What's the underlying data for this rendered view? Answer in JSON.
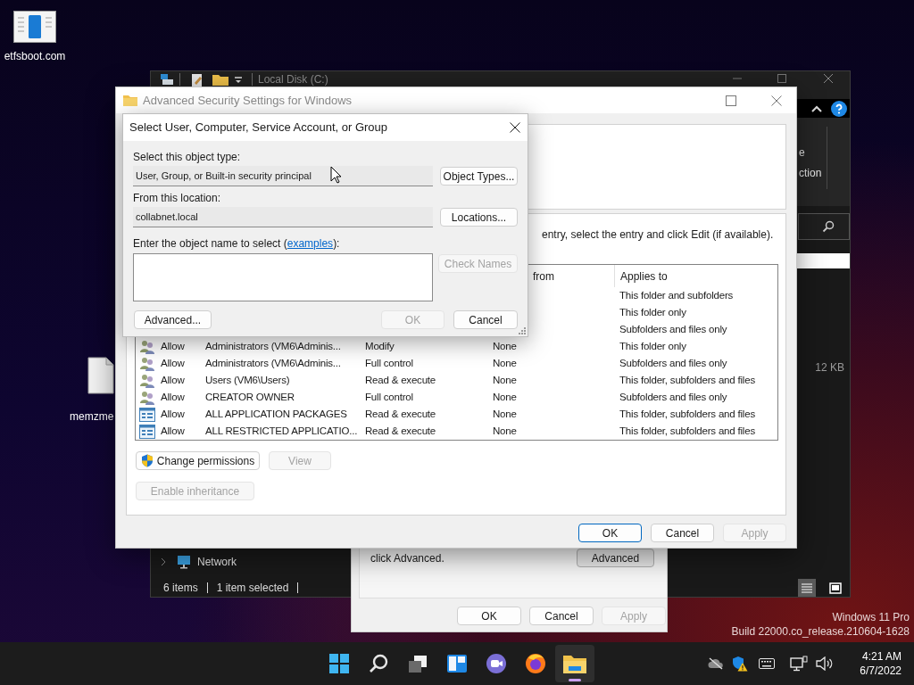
{
  "desktop": {
    "icons": [
      {
        "label": "etfsboot.com",
        "kind": "app"
      },
      {
        "label": "memzme",
        "kind": "file"
      }
    ]
  },
  "explorer": {
    "title": "Local Disk (C:)",
    "ribbon_fragments": [
      "e",
      "ction"
    ],
    "file_size": "12 KB",
    "nav_item": "Network",
    "status": [
      "6 items",
      "1 item selected"
    ]
  },
  "properties_dialog": {
    "note": "click Advanced.",
    "advanced_button": "Advanced",
    "buttons": [
      {
        "label": "OK",
        "disabled": false
      },
      {
        "label": "Cancel",
        "disabled": false
      },
      {
        "label": "Apply",
        "disabled": true
      }
    ]
  },
  "advanced_security": {
    "title": "Advanced Security Settings for Windows",
    "instruction": "entry, select the entry and click Edit (if available).",
    "columns": {
      "column_4": "from",
      "column_5": "Applies to"
    },
    "rows": [
      {
        "applies_to": "This folder and subfolders"
      },
      {
        "applies_to": "This folder only"
      },
      {
        "applies_to": "Subfolders and files only"
      },
      {
        "kind": "group",
        "type": "Allow",
        "principal": "Administrators (VM6\\Adminis...",
        "access": "Modify",
        "inherited": "None",
        "applies_to": "This folder only"
      },
      {
        "kind": "group",
        "type": "Allow",
        "principal": "Administrators (VM6\\Adminis...",
        "access": "Full control",
        "inherited": "None",
        "applies_to": "Subfolders and files only"
      },
      {
        "kind": "group",
        "type": "Allow",
        "principal": "Users (VM6\\Users)",
        "access": "Read & execute",
        "inherited": "None",
        "applies_to": "This folder, subfolders and files"
      },
      {
        "kind": "group",
        "type": "Allow",
        "principal": "CREATOR OWNER",
        "access": "Full control",
        "inherited": "None",
        "applies_to": "Subfolders and files only"
      },
      {
        "kind": "package",
        "type": "Allow",
        "principal": "ALL APPLICATION PACKAGES",
        "access": "Read & execute",
        "inherited": "None",
        "applies_to": "This folder, subfolders and files"
      },
      {
        "kind": "package",
        "type": "Allow",
        "principal": "ALL RESTRICTED APPLICATIO...",
        "access": "Read & execute",
        "inherited": "None",
        "applies_to": "This folder, subfolders and files"
      }
    ],
    "actions": [
      {
        "label": "Change permissions",
        "disabled": false,
        "shield": true
      },
      {
        "label": "View",
        "disabled": true,
        "shield": false
      }
    ],
    "inheritance_button": {
      "label": "Enable inheritance",
      "disabled": true
    },
    "buttons": [
      {
        "label": "OK",
        "disabled": false,
        "default": true
      },
      {
        "label": "Cancel",
        "disabled": false,
        "default": false
      },
      {
        "label": "Apply",
        "disabled": true,
        "default": false
      }
    ]
  },
  "select_dialog": {
    "title": "Select User, Computer, Service Account, or Group",
    "object_type_label": "Select this object type:",
    "object_type": "User, Group, or Built-in security principal",
    "object_types_button": "Object Types...",
    "location_label": "From this location:",
    "location": "collabnet.local",
    "locations_button": "Locations...",
    "name_label_before": "Enter the object name to select (",
    "name_label_link": "examples",
    "name_label_after": "):",
    "check_names": {
      "label": "Check Names",
      "disabled": true
    },
    "buttons": [
      {
        "label": "Advanced...",
        "disabled": false
      },
      {
        "label": "OK",
        "disabled": true
      },
      {
        "label": "Cancel",
        "disabled": false
      }
    ]
  },
  "taskbar": {
    "apps": [
      {
        "kind": "start",
        "active": false
      },
      {
        "kind": "search",
        "active": false
      },
      {
        "kind": "task_view",
        "active": false
      },
      {
        "kind": "widgets",
        "active": false
      },
      {
        "kind": "chat",
        "active": false
      },
      {
        "kind": "browser",
        "active": false
      },
      {
        "kind": "explorer",
        "active": true
      }
    ],
    "clock": {
      "time": "4:21 AM",
      "date": "6/7/2022"
    }
  },
  "watermark": [
    "Windows 11 Pro",
    "Build 22000.co_release.210604-1628"
  ]
}
